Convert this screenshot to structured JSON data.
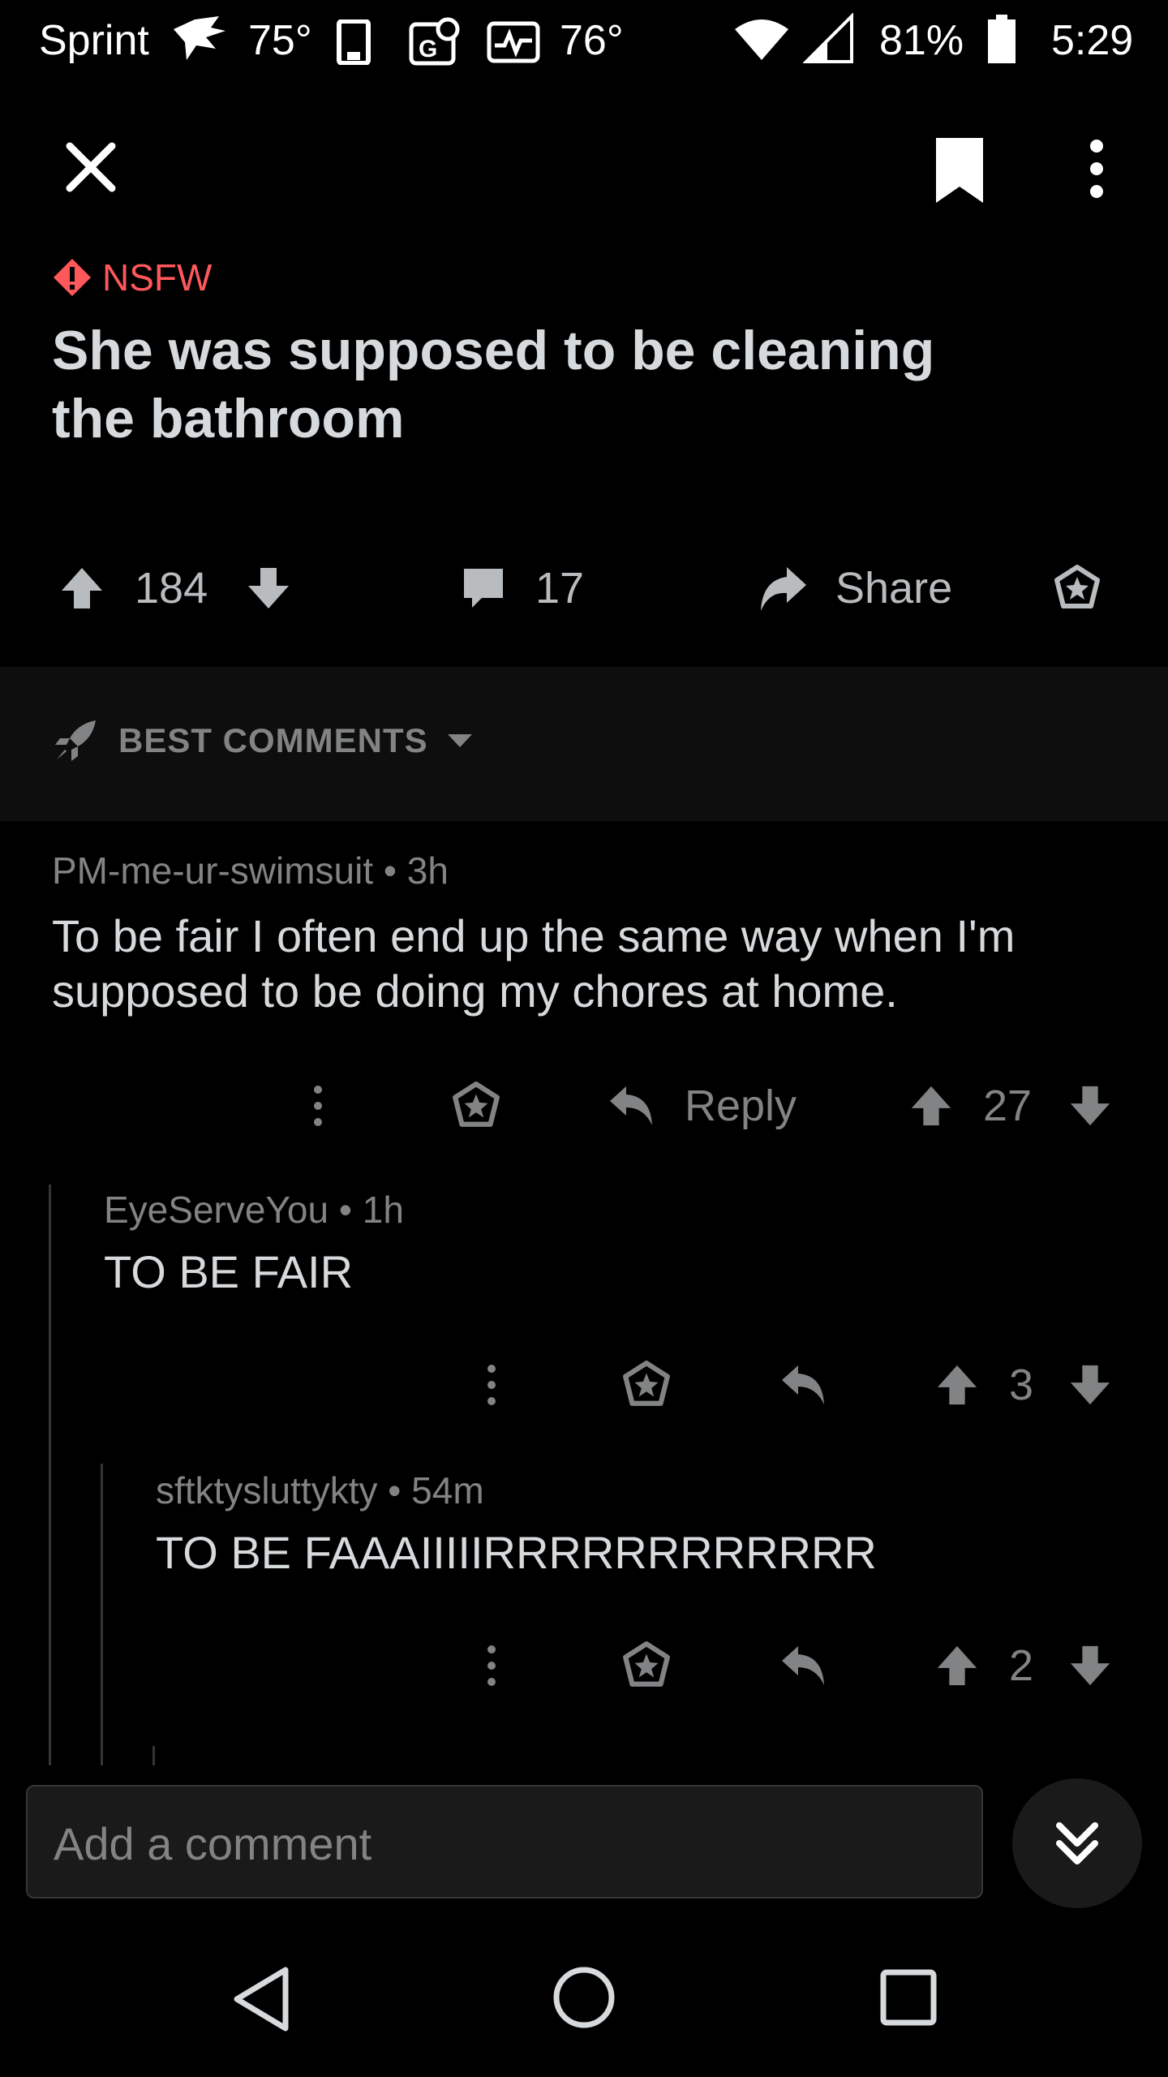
{
  "status_bar": {
    "carrier": "Sprint",
    "temp1": "75°",
    "temp2": "76°",
    "battery": "81%",
    "time": "5:29"
  },
  "post": {
    "nsfw_label": "NSFW",
    "title": "She was supposed to be cleaning the bathroom",
    "upvotes": "184",
    "comments": "17",
    "share_label": "Share"
  },
  "sort": {
    "label": "BEST COMMENTS"
  },
  "comments": [
    {
      "author": "PM-me-ur-swimsuit",
      "time": "3h",
      "text": "To be fair I often end up the same way when I'm supposed to be doing my chores at home.",
      "reply_label": "Reply",
      "score": "27"
    },
    {
      "author": "EyeServeYou",
      "time": "1h",
      "text": "TO BE FAIR",
      "score": "3"
    },
    {
      "author": "sftktysluttykty",
      "time": "54m",
      "text": "TO BE FAAAIIIIIRRRRRRRRRRRR",
      "score": "2"
    }
  ],
  "composer": {
    "placeholder": "Add a comment"
  },
  "colors": {
    "background": "#000000",
    "nsfw": "#ff585b",
    "text": "#d7dadc",
    "muted": "#818384"
  }
}
